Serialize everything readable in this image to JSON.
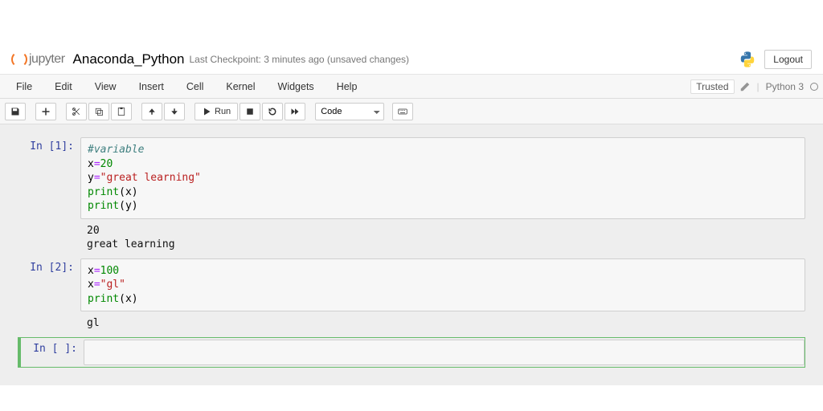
{
  "header": {
    "logo_text": "jupyter",
    "title": "Anaconda_Python",
    "checkpoint": "Last Checkpoint: 3 minutes ago  (unsaved changes)",
    "logout": "Logout"
  },
  "menubar": {
    "items": [
      "File",
      "Edit",
      "View",
      "Insert",
      "Cell",
      "Kernel",
      "Widgets",
      "Help"
    ],
    "trusted": "Trusted",
    "kernel": "Python 3"
  },
  "toolbar": {
    "run_label": "Run",
    "cell_type": "Code"
  },
  "cells": [
    {
      "prompt": "In [1]:",
      "code_tokens": [
        {
          "cls": "tk-comment",
          "t": "#variable"
        },
        {
          "t": "\n"
        },
        {
          "cls": "tk-var",
          "t": "x"
        },
        {
          "cls": "tk-op",
          "t": "="
        },
        {
          "cls": "tk-num",
          "t": "20"
        },
        {
          "t": "\n"
        },
        {
          "cls": "tk-var",
          "t": "y"
        },
        {
          "cls": "tk-op",
          "t": "="
        },
        {
          "cls": "tk-str",
          "t": "\"great learning\""
        },
        {
          "t": "\n"
        },
        {
          "cls": "tk-fn",
          "t": "print"
        },
        {
          "cls": "tk-par",
          "t": "("
        },
        {
          "cls": "tk-var",
          "t": "x"
        },
        {
          "cls": "tk-par",
          "t": ")"
        },
        {
          "t": "\n"
        },
        {
          "cls": "tk-fn",
          "t": "print"
        },
        {
          "cls": "tk-par",
          "t": "("
        },
        {
          "cls": "tk-var",
          "t": "y"
        },
        {
          "cls": "tk-par",
          "t": ")"
        }
      ],
      "output": "20\ngreat learning"
    },
    {
      "prompt": "In [2]:",
      "code_tokens": [
        {
          "cls": "tk-var",
          "t": "x"
        },
        {
          "cls": "tk-op",
          "t": "="
        },
        {
          "cls": "tk-num",
          "t": "100"
        },
        {
          "t": "\n"
        },
        {
          "cls": "tk-var",
          "t": "x"
        },
        {
          "cls": "tk-op",
          "t": "="
        },
        {
          "cls": "tk-str",
          "t": "\"gl\""
        },
        {
          "t": "\n"
        },
        {
          "cls": "tk-fn",
          "t": "print"
        },
        {
          "cls": "tk-par",
          "t": "("
        },
        {
          "cls": "tk-var",
          "t": "x"
        },
        {
          "cls": "tk-par",
          "t": ")"
        }
      ],
      "output": "gl"
    },
    {
      "prompt": "In [ ]:",
      "code_tokens": [],
      "output": null,
      "selected": true
    }
  ]
}
